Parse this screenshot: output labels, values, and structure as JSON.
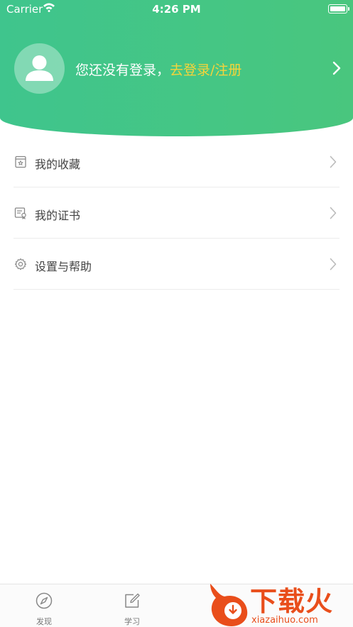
{
  "status_bar": {
    "carrier": "Carrier",
    "time": "4:26 PM"
  },
  "profile": {
    "prompt": "您还没有登录，",
    "login_link": "去登录/注册"
  },
  "menu": {
    "items": [
      {
        "label": "我的收藏",
        "icon": "bookmark-icon"
      },
      {
        "label": "我的证书",
        "icon": "certificate-icon"
      },
      {
        "label": "设置与帮助",
        "icon": "gear-icon"
      }
    ]
  },
  "tabbar": {
    "tabs": [
      {
        "label": "发现",
        "icon": "compass-icon"
      },
      {
        "label": "学习",
        "icon": "edit-icon"
      }
    ]
  },
  "watermark": {
    "brand": "下载火",
    "site": "xiazaihuo.com"
  },
  "colors": {
    "header_green": "#46c684",
    "link_yellow": "#f6d43a",
    "watermark_orange": "#e94e1b"
  }
}
